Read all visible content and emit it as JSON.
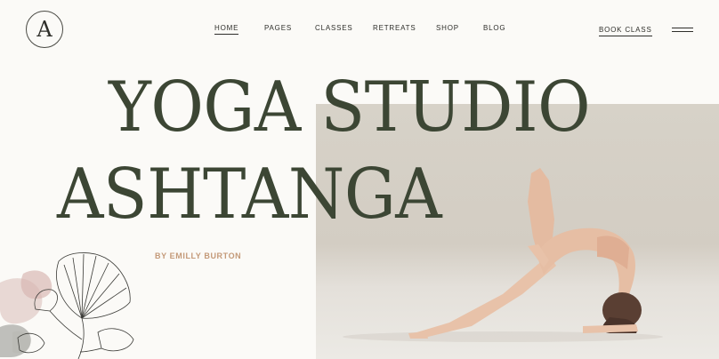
{
  "header": {
    "logo_letter": "A",
    "nav": [
      {
        "label": "HOME",
        "active": true
      },
      {
        "label": "PAGES",
        "active": false
      },
      {
        "label": "CLASSES",
        "active": false
      },
      {
        "label": "RETREATS",
        "active": false
      },
      {
        "label": "SHOP",
        "active": false
      },
      {
        "label": "BLOG",
        "active": false
      }
    ],
    "cta_label": "BOOK CLASS",
    "menu_icon": "hamburger-icon"
  },
  "hero": {
    "title_line_1": "YOGA STUDIO",
    "title_line_2": "ASHTANGA",
    "byline": "BY EMILLY BURTON",
    "image": "yoga-pose-photo",
    "decoration": "ginkgo-leaf-illustration"
  },
  "colors": {
    "background": "#fbfaf7",
    "headline": "#3c4634",
    "byline": "#c49a79",
    "photo_backdrop": "#d7d2c8",
    "text_dark": "#2e2e2a"
  }
}
